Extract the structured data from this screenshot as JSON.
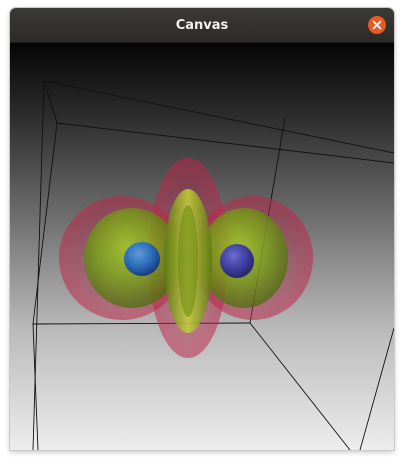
{
  "window": {
    "title": "Canvas"
  },
  "titlebar": {
    "close_icon": "close-icon",
    "close_color": "#e65a25"
  },
  "scene": {
    "description_icon": "orbital-isosurface",
    "colors": {
      "outer_shell": "#c0264a",
      "mid_shell": "#7fae1a",
      "inner_core": "#2a6bb6",
      "box_lines": "#111111"
    }
  }
}
